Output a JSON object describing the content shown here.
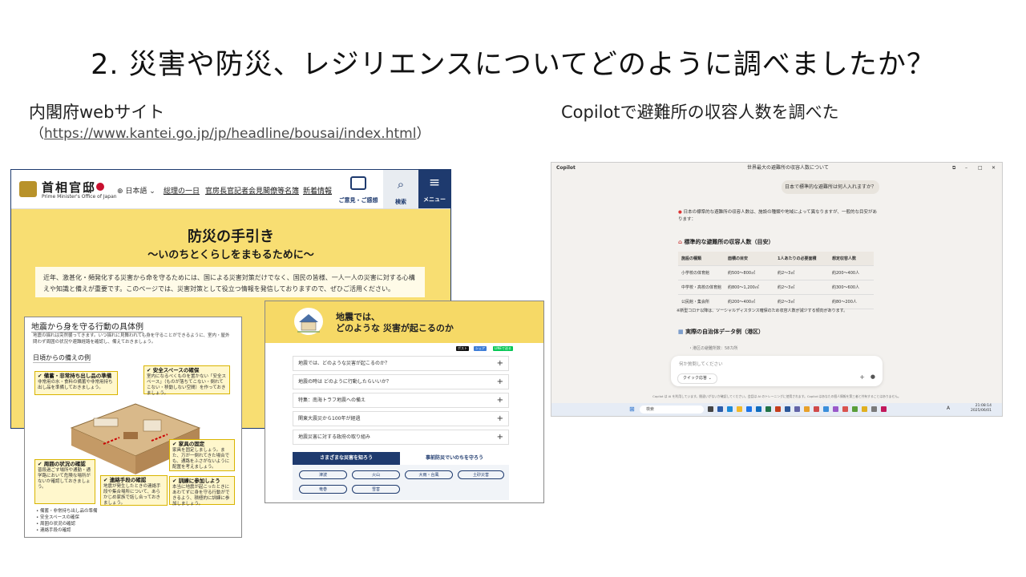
{
  "slide": {
    "title": "2.  災害や防災、レジリエンスについてどのように調べましたか？",
    "left_caption": "内閣府webサイト",
    "url_open": "（",
    "url": "https://www.kantei.go.jp/jp/headline/bousai/index.html",
    "url_close": "）",
    "right_caption": "Copilotで避難所の収容人数を調べた"
  },
  "kantei": {
    "logo": "首相官邸",
    "logo_sub": "Prime Minister's Office of Japan",
    "lang": "⊕ 日本語 ⌄",
    "nav": [
      "総理の一日",
      "官房長官記者会見",
      "閣僚等名簿",
      "新着情報"
    ],
    "opinion": "ご意見・ご感想",
    "search": "検索",
    "menu": "メニュー",
    "hero_title": "防災の手引き",
    "hero_subtitle": "～いのちとくらしをまもるために～",
    "intro": "近年、激甚化・頻発化する災害から命を守るためには、国による災害対策だけでなく、国民の皆様、一人一人の災害に対する心構えや知識と備えが重要です。このページでは、災害対策として役立つ情報を発信しておりますので、ぜひご活用ください。"
  },
  "leaflet": {
    "title": "地震から身を守る行動の具体例",
    "text": "地震の揺れは突然襲ってきます。いつ揺れに見舞われても身を守ることができるように、室内・屋外問わず周囲の状況や避難経路を確認し、備えておきましょう。",
    "subtitle": "日頃からの備えの例",
    "box1_title": "✔ 備蓄・非常持ち出し品の準備",
    "box1_text": "非常用の水・食料の備蓄や非常用持ち出し品を準備しておきましょう。",
    "box2_title": "✔ 安全スペースの確保",
    "box2_text": "室内になるべくものを置かない「安全スペース」（ものが落ちてこない・倒れてこない・移動しない空間）を作っておきましょう。",
    "box3_title": "✔ 家具の固定",
    "box3_text": "家具を固定しましょう。また、万が一倒れてきた場合でも、通路をふさがないように配置を考えましょう。",
    "box4_title": "✔ 周囲の状況の確認",
    "box4_text": "普段過ごす場所や通勤・通学路において危険な場所がないか確認しておきましょう。",
    "box5_title": "✔ 連絡手段の確認",
    "box5_text": "地震が発生したときの連絡手段や集合場所について、あらかじめ家族で話し合っておきましょう。",
    "box6_title": "✔ 訓練に参加しよう",
    "box6_text": "本当に地震が起こったときにあわてずに身を守る行動ができるよう、積極的に訓練に参加しましょう。",
    "list": [
      "備蓄・非常持ち出し品の準備",
      "安全スペースの確保",
      "周囲の状況の確認",
      "連絡手段の確認"
    ]
  },
  "quake": {
    "title_line1": "地震では、",
    "title_line2": "どのような 災害が起こるのか",
    "share": [
      "ポスト",
      "シェア",
      "LINEで送る"
    ],
    "rows": [
      "地震では、どのような災害が起こるのか？",
      "地震の時は どのように行動したらいいか？",
      "特集：南海トラフ地震への備え",
      "関東大震災から100年が経過",
      "地震災害に対する政府の取り組み"
    ],
    "plus": "+",
    "tab_active": "さまざまな災害を知ろう",
    "tab_inactive": "事前防災でいのちを守ろう",
    "buttons": [
      "津波",
      "火山",
      "大雨・台風",
      "土砂災害",
      "竜巻",
      "雪害"
    ]
  },
  "copilot": {
    "app": "Copilot",
    "window_title": "世界最大の避難所の収容人数について",
    "user_msg": "日本で標準的な避難所は何人入れますか？",
    "answer": "日本の標準的な避難所の収容人数は、施設の種類や地域によって異なりますが、一般的な目安があります：",
    "heading1": "標準的な避難所の収容人数（目安）",
    "table_headers": [
      "施設の種類",
      "面積の目安",
      "1人あたりの必要面積",
      "想定収容人数"
    ],
    "table_rows": [
      [
        "小学校の体育館",
        "約500～800㎡",
        "約2～3㎡",
        "約200～400人"
      ],
      [
        "中学校・高校の体育館",
        "約800～1,200㎡",
        "約2～3㎡",
        "約300～600人"
      ],
      [
        "公民館・集会所",
        "約200～400㎡",
        "約2～3㎡",
        "約80～200人"
      ]
    ],
    "note": "※新型コロナ以降は、ソーシャルディスタンス確保のため収容人数が減少する傾向があります。",
    "heading2": "実際の自治体データ例（港区）",
    "sub": "・港区の避難所数：58カ所",
    "input_placeholder": "何か質問してください",
    "mode": "クイック応答 ⌄",
    "footer": "Copilot は AI を利用しています。間違いがないか確認してください。会話は AI のトレーニングに使用されます。Copilot はあなたの個人情報を第三者と共有することはありません。",
    "taskbar_search": "検索",
    "taskbar_time": "21:08:14",
    "taskbar_date": "2025/06/01",
    "taskbar_lang": "A"
  }
}
